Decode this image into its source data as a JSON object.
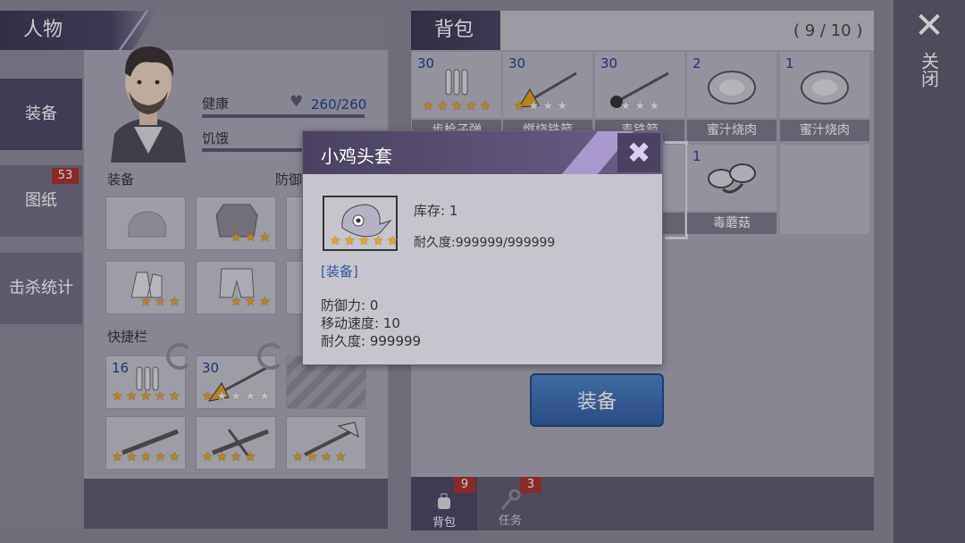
{
  "left_panel": {
    "title": "人物"
  },
  "sidebar": {
    "tabs": [
      {
        "label": "装备"
      },
      {
        "label": "图纸",
        "badge": "53"
      },
      {
        "label": "击杀统计"
      }
    ]
  },
  "character": {
    "health_label": "健康",
    "health_value": "260/260",
    "hunger_label": "饥饿"
  },
  "equipment": {
    "section_label": "装备",
    "defense_label": "防御",
    "slots": [
      {
        "item": "helmet",
        "stars": 0
      },
      {
        "item": "armor",
        "stars": 3
      },
      {
        "item": "gloves",
        "stars": 3
      },
      {
        "item": "pants",
        "stars": 3
      }
    ]
  },
  "quickbar": {
    "section_label": "快捷栏",
    "slots": [
      {
        "count": "16",
        "item": "bullets",
        "stars": 5
      },
      {
        "count": "30",
        "item": "fire-spear",
        "stars": 1
      },
      {
        "item": "locked"
      },
      {
        "item": "rifle",
        "stars": 5
      },
      {
        "item": "crossbow",
        "stars": 4
      },
      {
        "item": "axe",
        "stars": 4
      }
    ]
  },
  "backpack": {
    "title": "背包",
    "capacity": "( 9 / 10 )",
    "items": [
      {
        "count": "30",
        "name": "步枪子弹",
        "stars": 5
      },
      {
        "count": "30",
        "name": "燃烧铁箭",
        "stars": 1
      },
      {
        "count": "30",
        "name": "毒铁箭",
        "stars": 1
      },
      {
        "count": "2",
        "name": "蜜汁烧肉",
        "stars": 0
      },
      {
        "count": "1",
        "name": "蜜汁烧肉",
        "stars": 0
      },
      {
        "count": "",
        "name": "",
        "stars": 0
      },
      {
        "count": "",
        "name": "",
        "stars": 0
      },
      {
        "count": "",
        "name": "头套",
        "stars": 1
      },
      {
        "count": "1",
        "name": "毒蘑菇",
        "stars": 0
      }
    ],
    "equip_button": "装备"
  },
  "bottom_tabs": [
    {
      "label": "背包",
      "badge": "9"
    },
    {
      "label": "任务",
      "badge": "3"
    }
  ],
  "close": {
    "label": "关闭"
  },
  "popup": {
    "title": "小鸡头套",
    "stock": "库存: 1",
    "durability": "耐久度:999999/999999",
    "tag": "[装备]",
    "stats": [
      "防御力: 0",
      "移动速度: 10",
      "耐久度: 999999"
    ],
    "stars": 5
  },
  "colors": {
    "star": "#e9a521",
    "accent": "#4a4260",
    "button": "#3f6fb0"
  }
}
